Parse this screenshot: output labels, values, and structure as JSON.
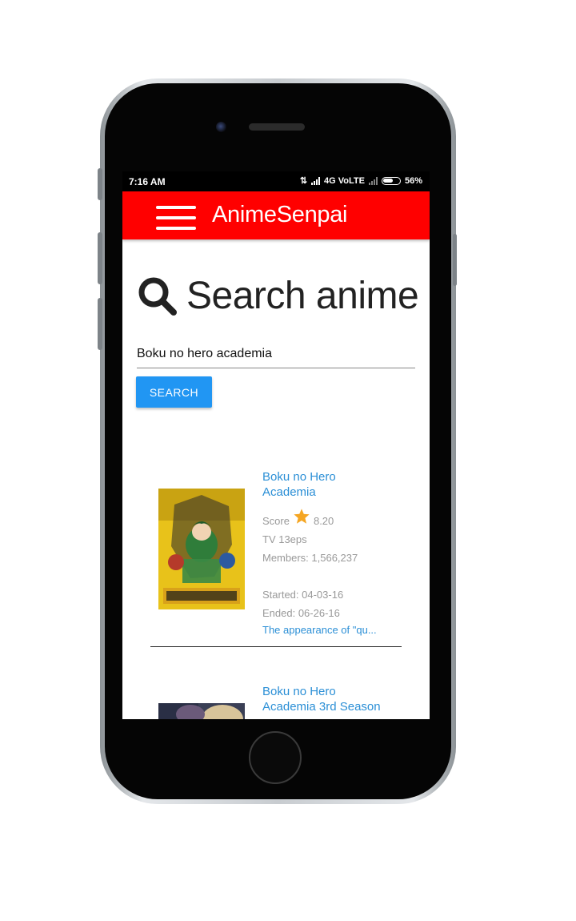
{
  "status_bar": {
    "time": "7:16 AM",
    "network": "4G VoLTE",
    "battery": "56%"
  },
  "app_bar": {
    "title": "AnimeSenpai"
  },
  "search": {
    "heading": "Search anime",
    "input_value": "Boku no hero academia",
    "button_label": "SEARCH"
  },
  "results": [
    {
      "title": "Boku no Hero Academia",
      "score_label": "Score",
      "score": "8.20",
      "type_eps": "TV 13eps",
      "members": "Members: 1,566,237",
      "started": "Started: 04-03-16",
      "ended": "Ended: 06-26-16",
      "synopsis": "The appearance of \"qu..."
    },
    {
      "title": "Boku no Hero Academia 3rd Season"
    }
  ],
  "colors": {
    "app_bar": "#ff0000",
    "button": "#2196f3",
    "link": "#2b8fd6",
    "star": "#f5a623"
  }
}
